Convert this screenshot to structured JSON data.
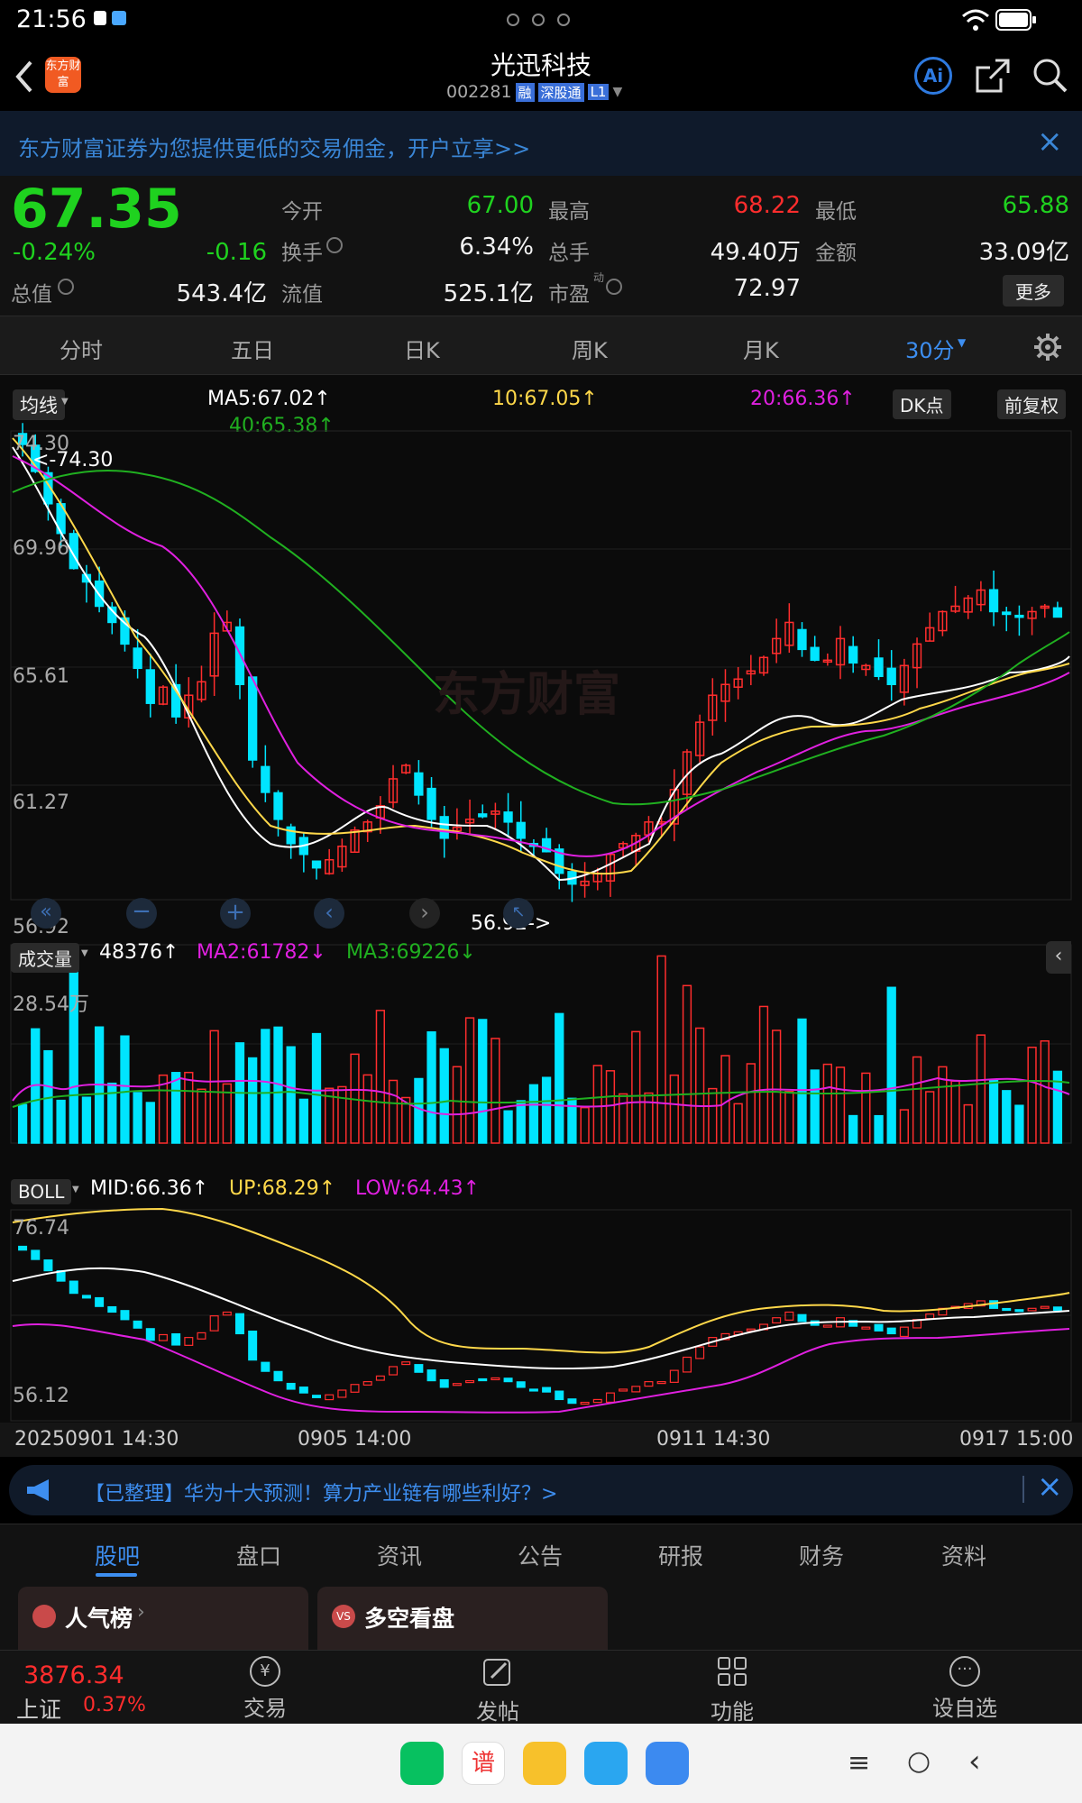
{
  "status": {
    "time": "21:56"
  },
  "nav": {
    "title": "光迅科技",
    "code": "002281",
    "tag_rong": "融",
    "tag_sgt": "深股通",
    "tag_l1": "L1",
    "logo_text": "东方财富"
  },
  "ad": {
    "text": "东方财富证券为您提供更低的交易佣金，开户立享>>"
  },
  "quote": {
    "price": "67.35",
    "change_pct": "-0.24%",
    "change": "-0.16",
    "open_label": "今开",
    "open": "67.00",
    "high_label": "最高",
    "high": "68.22",
    "low_label": "最低",
    "low": "65.88",
    "turnover_label": "换手",
    "turnover": "6.34%",
    "volume_label": "总手",
    "volume": "49.40万",
    "amount_label": "金额",
    "amount": "33.09亿",
    "mktcap_label": "总值",
    "mktcap": "543.4亿",
    "float_label": "流值",
    "float": "525.1亿",
    "pe_label": "市盈",
    "pe_sup": "动",
    "pe": "72.97",
    "more": "更多"
  },
  "periods": [
    "分时",
    "五日",
    "日K",
    "周K",
    "月K",
    "30分"
  ],
  "colors": {
    "up": "#ff2d2d",
    "down": "#00e5ff",
    "green": "#1fd21f",
    "ma5": "#ffffff",
    "ma10": "#ffd84a",
    "ma20": "#e020e0",
    "ma40": "#20b020"
  },
  "main_chart": {
    "selector": "均线",
    "ma5": "MA5:67.02↑",
    "ma10": "10:67.05↑",
    "ma20": "20:66.36↑",
    "ma40": "40:65.38↑",
    "dk": "DK点",
    "fq": "前复权",
    "high_marker": "<-74.30",
    "low_marker": "56.92->",
    "watermark": "东方财富",
    "yticks": [
      "74.30",
      "69.96",
      "65.61",
      "61.27",
      "56.92"
    ]
  },
  "volume_chart": {
    "selector": "成交量",
    "v1": "48376↑",
    "ma2": "MA2:61782↓",
    "ma3": "MA3:69226↓",
    "ymax": "28.54万"
  },
  "boll_chart": {
    "selector": "BOLL",
    "mid": "MID:66.36↑",
    "up": "UP:68.29↑",
    "low": "LOW:64.43↑",
    "ymax": "76.74",
    "ymin": "56.12"
  },
  "xlabels": [
    "20250901 14:30",
    "0905 14:00",
    "0911 14:30",
    "0917 15:00"
  ],
  "chart_data": {
    "type": "candlestick",
    "price_range": [
      56.92,
      74.3
    ],
    "close_path": [
      73.8,
      72.8,
      71.6,
      70.5,
      69.2,
      68.7,
      67.8,
      67.2,
      66.4,
      65.5,
      64.2,
      64.8,
      63.7,
      64.5,
      65.0,
      66.8,
      67.2,
      64.9,
      62.1,
      60.9,
      59.9,
      59.0,
      58.6,
      58.1,
      58.4,
      58.9,
      59.5,
      59.8,
      60.4,
      61.4,
      61.9,
      60.8,
      59.9,
      59.2,
      59.6,
      59.9,
      60.0,
      60.2,
      59.8,
      59.2,
      58.9,
      58.7,
      57.9,
      57.5,
      57.6,
      57.9,
      58.6,
      59.0,
      59.3,
      59.8,
      59.8,
      61.0,
      62.4,
      63.5,
      64.5,
      64.9,
      65.1,
      65.4,
      65.9,
      66.6,
      67.2,
      66.2,
      65.8,
      65.8,
      66.6,
      65.7,
      65.6,
      65.2,
      64.9,
      65.6,
      66.4,
      67.0,
      67.6,
      67.8,
      68.1,
      68.4,
      67.6,
      67.5,
      67.4,
      67.6,
      67.8,
      67.4
    ],
    "volume_max": "28.54万"
  },
  "news": {
    "text": "【已整理】华为十大预测！算力产业链有哪些利好？>"
  },
  "tabs": [
    "股吧",
    "盘口",
    "资讯",
    "公告",
    "研报",
    "财务",
    "资料"
  ],
  "cards": [
    {
      "title": "人气榜"
    },
    {
      "title": "多空看盘"
    }
  ],
  "bottom": {
    "index_value": "3876.34",
    "index_name": "上证",
    "index_pct": "0.37%",
    "items": [
      "交易",
      "发帖",
      "功能",
      "设自选"
    ]
  }
}
